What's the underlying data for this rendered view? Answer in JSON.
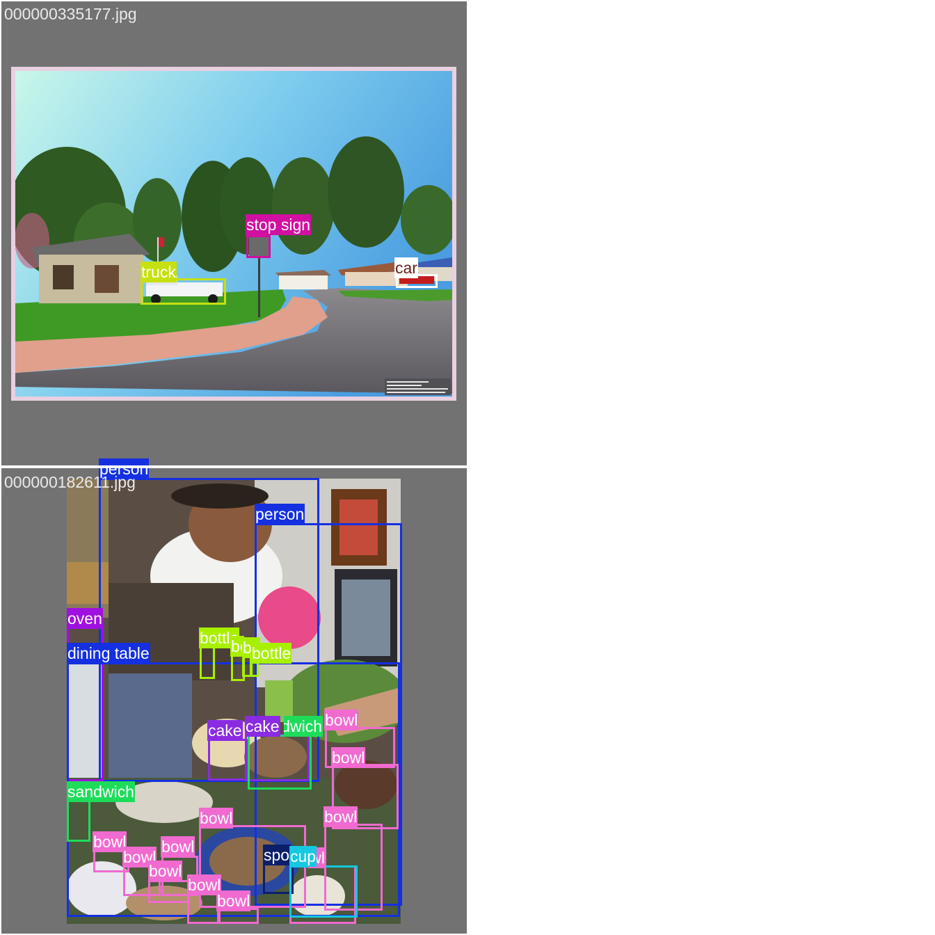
{
  "panels": [
    {
      "filename": "000000335177.jpg",
      "detections": [
        {
          "label": "stop sign",
          "color": "#d10fa1"
        },
        {
          "label": "truck",
          "color": "#c7e00f"
        },
        {
          "label": "car",
          "color": "#ffffff",
          "label_color": "#6b1c12"
        }
      ]
    },
    {
      "filename": "000000182611.jpg",
      "detections": [
        {
          "label": "person",
          "color": "#1430e0"
        },
        {
          "label": "person",
          "color": "#1430e0"
        },
        {
          "label": "oven",
          "color": "#a010e0"
        },
        {
          "label": "dining table",
          "color": "#1430e0"
        },
        {
          "label": "bottle",
          "color": "#a8f000"
        },
        {
          "label": "bottle",
          "color": "#a8f000"
        },
        {
          "label": "bottle",
          "color": "#a8f000"
        },
        {
          "label": "bottle",
          "color": "#a8f000"
        },
        {
          "label": "cake",
          "color": "#8a2be2"
        },
        {
          "label": "cake",
          "color": "#8a2be2"
        },
        {
          "label": "sandwich",
          "color": "#1edc5a"
        },
        {
          "label": "sandwich",
          "color": "#1edc5a"
        },
        {
          "label": "bowl",
          "color": "#f06ad0"
        },
        {
          "label": "bowl",
          "color": "#f06ad0"
        },
        {
          "label": "bowl",
          "color": "#f06ad0"
        },
        {
          "label": "bowl",
          "color": "#f06ad0"
        },
        {
          "label": "bowl",
          "color": "#f06ad0"
        },
        {
          "label": "bowl",
          "color": "#f06ad0"
        },
        {
          "label": "bowl",
          "color": "#f06ad0"
        },
        {
          "label": "bowl",
          "color": "#f06ad0"
        },
        {
          "label": "bowl",
          "color": "#f06ad0"
        },
        {
          "label": "bowl",
          "color": "#f06ad0"
        },
        {
          "label": "bowl",
          "color": "#f06ad0"
        },
        {
          "label": "spoon",
          "color": "#0b1f6a"
        },
        {
          "label": "cup",
          "color": "#16c8e0"
        }
      ]
    }
  ]
}
